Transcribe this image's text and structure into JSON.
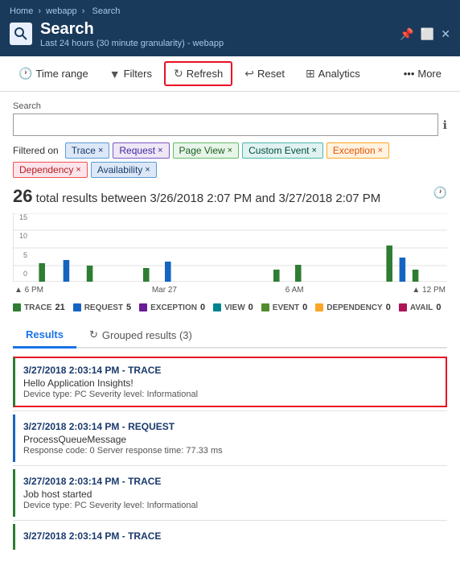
{
  "breadcrumb": {
    "items": [
      "Home",
      "webapp",
      "Search"
    ]
  },
  "header": {
    "title": "Search",
    "subtitle": "Last 24 hours (30 minute granularity) - webapp",
    "icon": "search"
  },
  "window_controls": {
    "pin": "📌",
    "maximize": "⬜",
    "close": "✕"
  },
  "toolbar": {
    "time_range": "Time range",
    "filters": "Filters",
    "refresh": "Refresh",
    "reset": "Reset",
    "analytics": "Analytics",
    "more": "More"
  },
  "search": {
    "label": "Search",
    "placeholder": "",
    "info_title": "info"
  },
  "filters": {
    "label": "Filtered on",
    "tags": [
      {
        "text": "Trace",
        "color": "blue"
      },
      {
        "text": "Request",
        "color": "purple"
      },
      {
        "text": "Page View",
        "color": "green"
      },
      {
        "text": "Custom Event",
        "color": "teal"
      },
      {
        "text": "Exception",
        "color": "orange"
      },
      {
        "text": "Dependency",
        "color": "red"
      },
      {
        "text": "Availability",
        "color": "blue"
      }
    ]
  },
  "results_summary": {
    "count": "26",
    "text": "total results between 3/26/2018 2:07 PM and 3/27/2018 2:07 PM"
  },
  "chart": {
    "y_labels": [
      "15",
      "10",
      "5",
      "0"
    ],
    "x_labels": [
      "6 PM",
      "Mar 27",
      "6 AM",
      "12 PM"
    ]
  },
  "legend": [
    {
      "label": "TRACE",
      "count": "21",
      "color": "#2e7d32"
    },
    {
      "label": "REQUEST",
      "count": "5",
      "color": "#1565c0"
    },
    {
      "label": "EXCEPTION",
      "count": "0",
      "color": "#6a1b9a"
    },
    {
      "label": "VIEW",
      "count": "0",
      "color": "#00838f"
    },
    {
      "label": "EVENT",
      "count": "0",
      "color": "#558b2f"
    },
    {
      "label": "DEPENDENCY",
      "count": "0",
      "color": "#f9a825"
    },
    {
      "label": "AVAIL",
      "count": "0",
      "color": "#ad1457"
    }
  ],
  "tabs": {
    "results": "Results",
    "grouped": "Grouped results (3)"
  },
  "result_items": [
    {
      "id": 1,
      "datetime": "3/27/2018 2:03:14 PM",
      "type": "TRACE",
      "body": "Hello Application Insights!",
      "meta": "Device type: PC Severity level: Informational",
      "color": "trace-green",
      "selected": true
    },
    {
      "id": 2,
      "datetime": "3/27/2018 2:03:14 PM",
      "type": "REQUEST",
      "body": "ProcessQueueMessage",
      "meta": "Response code: 0 Server response time: 77.33 ms",
      "color": "request-blue",
      "selected": false
    },
    {
      "id": 3,
      "datetime": "3/27/2018 2:03:14 PM",
      "type": "TRACE",
      "body": "Job host started",
      "meta": "Device type: PC Severity level: Informational",
      "color": "trace-green",
      "selected": false
    },
    {
      "id": 4,
      "datetime": "3/27/2018 2:03:14 PM",
      "type": "TRACE",
      "body": "",
      "meta": "",
      "color": "trace-green",
      "selected": false
    }
  ]
}
